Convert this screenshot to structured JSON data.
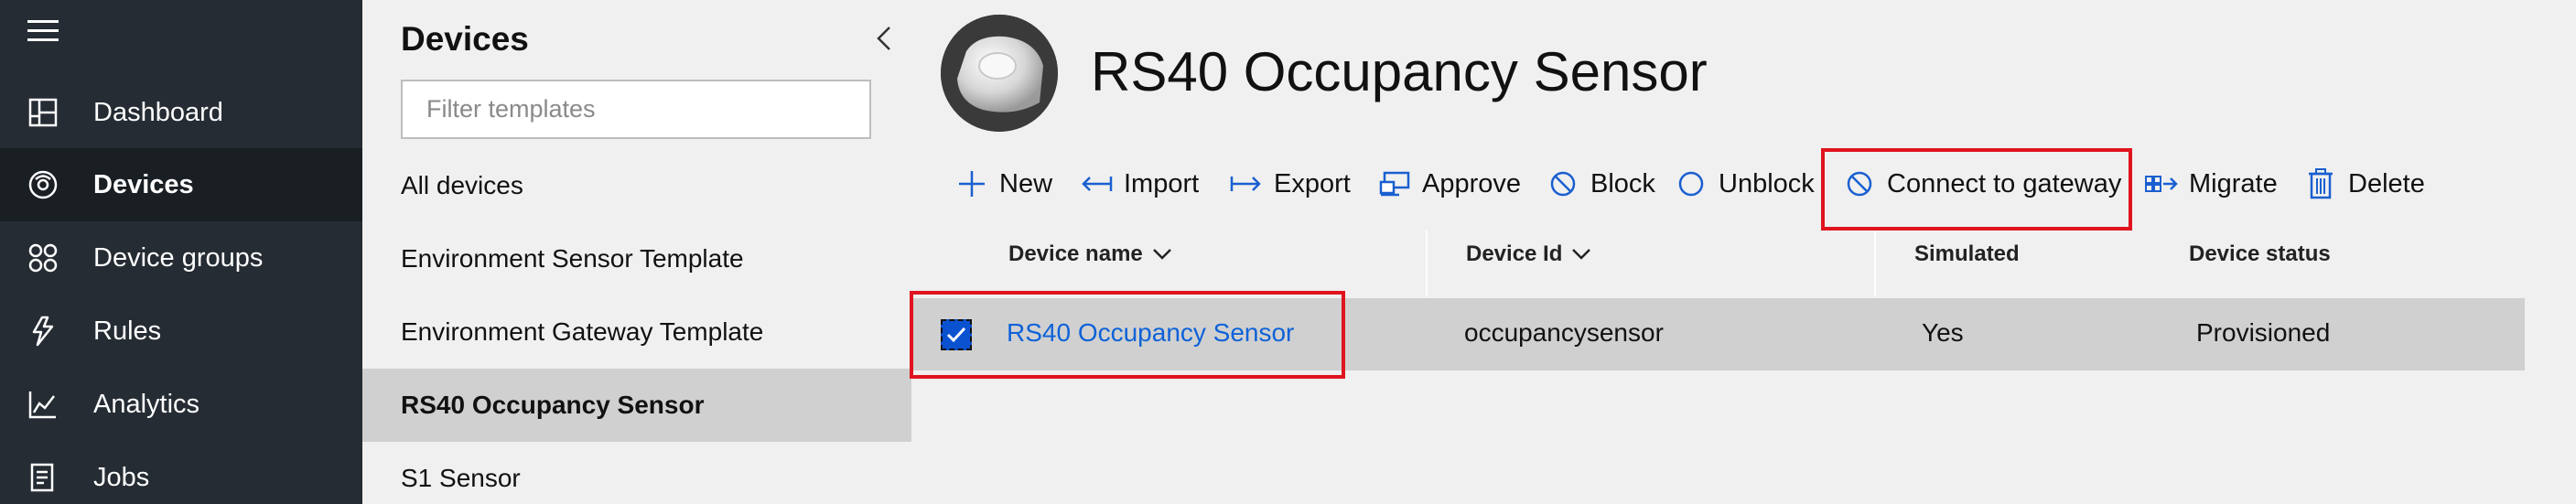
{
  "nav": {
    "items": [
      {
        "label": "Dashboard",
        "icon": "dashboard-icon"
      },
      {
        "label": "Devices",
        "icon": "devices-icon",
        "active": true
      },
      {
        "label": "Device groups",
        "icon": "device-groups-icon"
      },
      {
        "label": "Rules",
        "icon": "rules-icon"
      },
      {
        "label": "Analytics",
        "icon": "analytics-icon"
      },
      {
        "label": "Jobs",
        "icon": "jobs-icon"
      }
    ]
  },
  "templates": {
    "title": "Devices",
    "filter_placeholder": "Filter templates",
    "items": [
      {
        "label": "All devices"
      },
      {
        "label": "Environment Sensor Template"
      },
      {
        "label": "Environment Gateway Template"
      },
      {
        "label": "RS40 Occupancy Sensor",
        "active": true
      },
      {
        "label": "S1 Sensor"
      }
    ]
  },
  "main": {
    "title": "RS40 Occupancy Sensor",
    "toolbar": {
      "new": "New",
      "import": "Import",
      "export": "Export",
      "approve": "Approve",
      "block": "Block",
      "unblock": "Unblock",
      "connect": "Connect to gateway",
      "migrate": "Migrate",
      "delete": "Delete"
    },
    "columns": {
      "device_name": "Device name",
      "device_id": "Device Id",
      "simulated": "Simulated",
      "status": "Device status"
    },
    "rows": [
      {
        "device_name": "RS40 Occupancy Sensor",
        "device_id": "occupancysensor",
        "simulated": "Yes",
        "status": "Provisioned",
        "selected": true
      }
    ]
  },
  "colors": {
    "nav_bg": "#252c33",
    "nav_active_bg": "#1a1f24",
    "accent": "#0b52d1",
    "link": "#0e62d8",
    "highlight": "#e0141f"
  }
}
